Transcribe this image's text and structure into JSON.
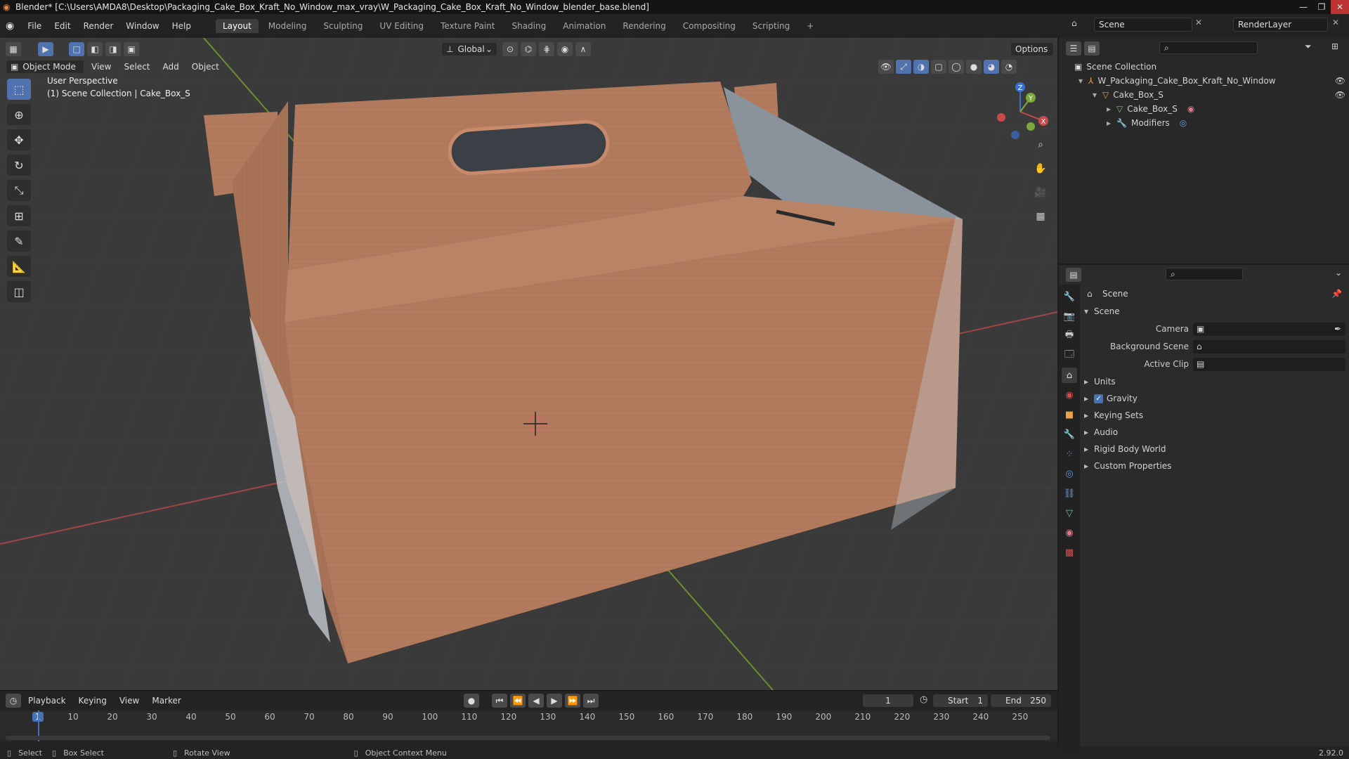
{
  "window": {
    "title": "Blender* [C:\\Users\\AMDA8\\Desktop\\Packaging_Cake_Box_Kraft_No_Window_max_vray\\W_Packaging_Cake_Box_Kraft_No_Window_blender_base.blend]"
  },
  "menu": [
    "File",
    "Edit",
    "Render",
    "Window",
    "Help"
  ],
  "workspaces": [
    "Layout",
    "Modeling",
    "Sculpting",
    "UV Editing",
    "Texture Paint",
    "Shading",
    "Animation",
    "Rendering",
    "Compositing",
    "Scripting"
  ],
  "scene_field": "Scene",
  "renderlayer_field": "RenderLayer",
  "viewport": {
    "mode": "Object Mode",
    "menus": [
      "View",
      "Select",
      "Add",
      "Object"
    ],
    "transform_orientation": "Global",
    "options_label": "Options",
    "overlay_title": "User Perspective",
    "overlay_subtitle": "(1) Scene Collection | Cake_Box_S",
    "gizmo_axes": {
      "z": "Z",
      "y": "Y",
      "x": "X"
    }
  },
  "timeline": {
    "menus": [
      "Playback",
      "Keying",
      "View",
      "Marker"
    ],
    "current_frame": "1",
    "start_label": "Start",
    "start_value": "1",
    "end_label": "End",
    "end_value": "250",
    "ruler": [
      "1",
      "10",
      "20",
      "30",
      "40",
      "50",
      "60",
      "70",
      "80",
      "90",
      "100",
      "110",
      "120",
      "130",
      "140",
      "150",
      "160",
      "170",
      "180",
      "190",
      "200",
      "210",
      "220",
      "230",
      "240",
      "250"
    ],
    "playhead_frame": 1
  },
  "status": {
    "select": "Select",
    "box_select": "Box Select",
    "rotate_view": "Rotate View",
    "context_menu": "Object Context Menu",
    "version": "2.92.0"
  },
  "outliner": {
    "root": "Scene Collection",
    "collection": "W_Packaging_Cake_Box_Kraft_No_Window",
    "object": "Cake_Box_S",
    "mesh": "Cake_Box_S",
    "modifiers": "Modifiers"
  },
  "properties": {
    "header": "Scene",
    "section": "Scene",
    "camera_label": "Camera",
    "background_scene_label": "Background Scene",
    "active_clip_label": "Active Clip",
    "subpanels": [
      "Units",
      "Gravity",
      "Keying Sets",
      "Audio",
      "Rigid Body World",
      "Custom Properties"
    ]
  },
  "colors": {
    "accent": "#4772b3",
    "box_kraft": "#b07a5c",
    "axis_x": "#c84a4a",
    "axis_y": "#7ea83a",
    "axis_z": "#3a70d0"
  }
}
